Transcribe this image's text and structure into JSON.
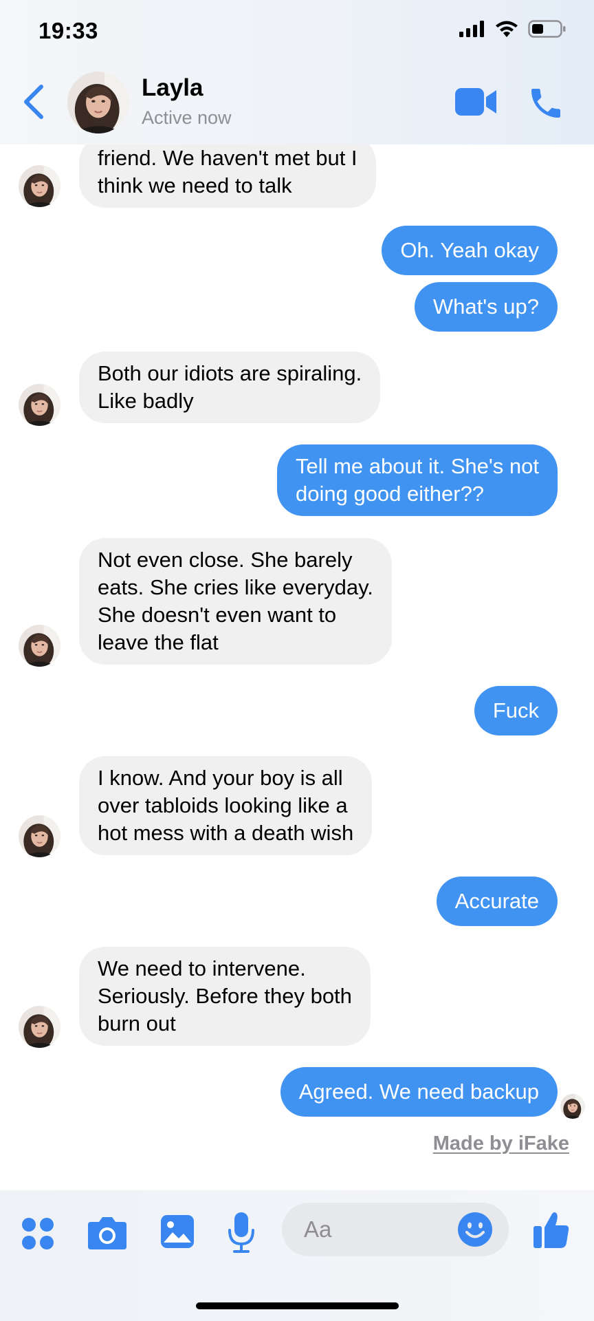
{
  "status_bar": {
    "time": "19:33"
  },
  "header": {
    "contact_name": "Layla",
    "contact_status": "Active now",
    "back_icon": "chevron-left-icon",
    "video_icon": "video-camera-icon",
    "call_icon": "phone-icon"
  },
  "messages": [
    {
      "from": "them",
      "text": "friend. We haven't met but I\nthink we need to talk"
    },
    {
      "from": "me",
      "text": "Oh. Yeah okay"
    },
    {
      "from": "me",
      "text": "What's up?"
    },
    {
      "from": "them",
      "text": "Both our idiots are spiraling.\nLike badly"
    },
    {
      "from": "me",
      "text": "Tell me about it. She's not\ndoing good either??"
    },
    {
      "from": "them",
      "text": "Not even close. She barely\neats. She cries like everyday.\nShe doesn't even want to\nleave the flat"
    },
    {
      "from": "me",
      "text": "Fuck"
    },
    {
      "from": "them",
      "text": "I know. And your boy is all\nover tabloids looking like a\nhot mess with a death wish"
    },
    {
      "from": "me",
      "text": "Accurate"
    },
    {
      "from": "them",
      "text": "We need to intervene.\nSeriously. Before they both\nburn out"
    },
    {
      "from": "me",
      "text": "Agreed. We need backup"
    }
  ],
  "watermark": "Made by iFake",
  "composer": {
    "placeholder": "Aa",
    "icons": [
      "apps-icon",
      "camera-icon",
      "gallery-icon",
      "microphone-icon",
      "emoji-icon",
      "thumbs-up-icon"
    ]
  },
  "colors": {
    "accent": "#4193f2",
    "incoming_bubble": "#f0f0f0"
  }
}
